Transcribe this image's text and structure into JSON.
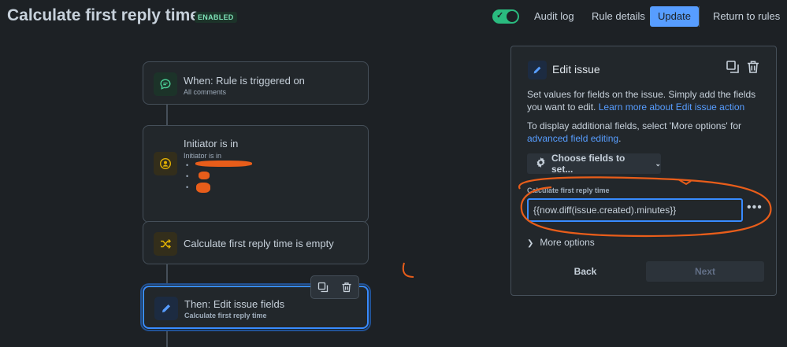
{
  "header": {
    "title": "Calculate first reply time ~",
    "status": "ENABLED",
    "toggle_on": true,
    "audit_log": "Audit log",
    "rule_details": "Rule details",
    "update": "Update",
    "return_to_rules": "Return to rules"
  },
  "flow": {
    "trigger": {
      "title": "When: Rule is triggered on",
      "subtitle": "All comments"
    },
    "condition_initiator": {
      "title": "Initiator is in",
      "subtitle": "Initiator is in"
    },
    "condition_field": {
      "title": "Calculate first reply time is empty"
    },
    "action": {
      "title": "Then: Edit issue fields",
      "subtitle": "Calculate first reply time"
    }
  },
  "panel": {
    "title": "Edit issue",
    "description": "Set values for fields on the issue. Simply add the fields you want to edit.",
    "learn_more_link": "Learn more about Edit issue action",
    "additional_text": "To display additional fields, select 'More options' for",
    "advanced_link": "advanced field editing",
    "period": ".",
    "choose_fields": "Choose fields to set...",
    "field_label": "Calculate first reply time",
    "field_value": "{{now.diff(issue.created).minutes}}",
    "more_options": "More options",
    "back": "Back",
    "next": "Next"
  },
  "colors": {
    "background": "#1d2125",
    "accent": "#579dff",
    "enabled_badge": "#7ee2b8",
    "toggle_on": "#2abb7f",
    "annotation": "#e85d1a"
  }
}
